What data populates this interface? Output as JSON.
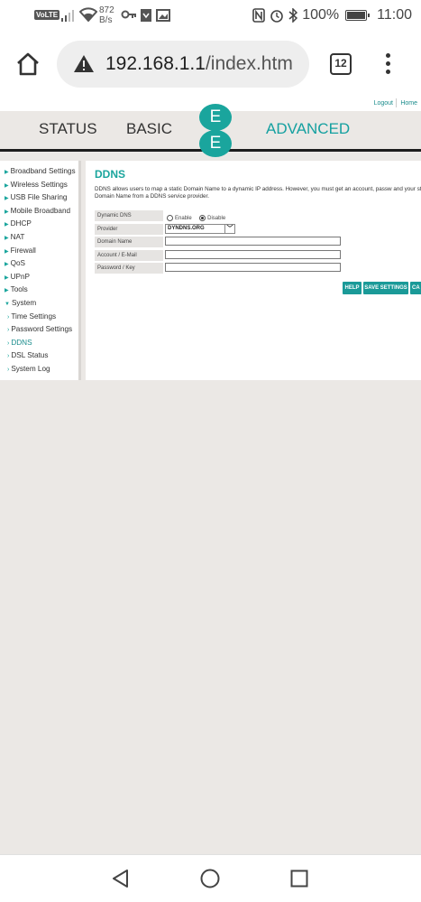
{
  "status_bar": {
    "volte": "VoLTE",
    "net_speed_value": "872",
    "net_speed_unit": "B/s",
    "battery": "100%",
    "time": "11:00"
  },
  "browser": {
    "url_host": "192.168.1.1",
    "url_path": "/index.htm",
    "tab_count": "12"
  },
  "router": {
    "top_links": {
      "logout": "Logout",
      "home": "Home"
    },
    "nav": {
      "status": "STATUS",
      "basic": "BASIC",
      "advanced": "ADVANCED"
    },
    "logo_letters": [
      "E",
      "E"
    ],
    "sidebar": [
      {
        "label": "Broadband Settings"
      },
      {
        "label": "Wireless Settings"
      },
      {
        "label": "USB File Sharing"
      },
      {
        "label": "Mobile Broadband"
      },
      {
        "label": "DHCP"
      },
      {
        "label": "NAT"
      },
      {
        "label": "Firewall"
      },
      {
        "label": "QoS"
      },
      {
        "label": "UPnP"
      },
      {
        "label": "Tools"
      },
      {
        "label": "System"
      },
      {
        "label": "Time Settings"
      },
      {
        "label": "Password Settings"
      },
      {
        "label": "DDNS"
      },
      {
        "label": "DSL Status"
      },
      {
        "label": "System Log"
      }
    ],
    "page": {
      "title": "DDNS",
      "description": "DDNS allows users to map a static Domain Name to a dynamic IP address. However, you must get an account, passw and your static Domain Name from a DDNS service provider.",
      "fields": {
        "dynamic_dns": {
          "label": "Dynamic DNS",
          "enable": "Enable",
          "disable": "Disable",
          "selected": "Disable"
        },
        "provider": {
          "label": "Provider",
          "value": "DYNDNS.ORG"
        },
        "domain_name": {
          "label": "Domain Name",
          "value": ""
        },
        "account": {
          "label": "Account / E-Mail",
          "value": ""
        },
        "password": {
          "label": "Password / Key",
          "value": ""
        }
      },
      "buttons": {
        "help": "HELP",
        "save": "SAVE SETTINGS",
        "cancel": "CA"
      }
    },
    "accent_color": "#1aa59d"
  }
}
